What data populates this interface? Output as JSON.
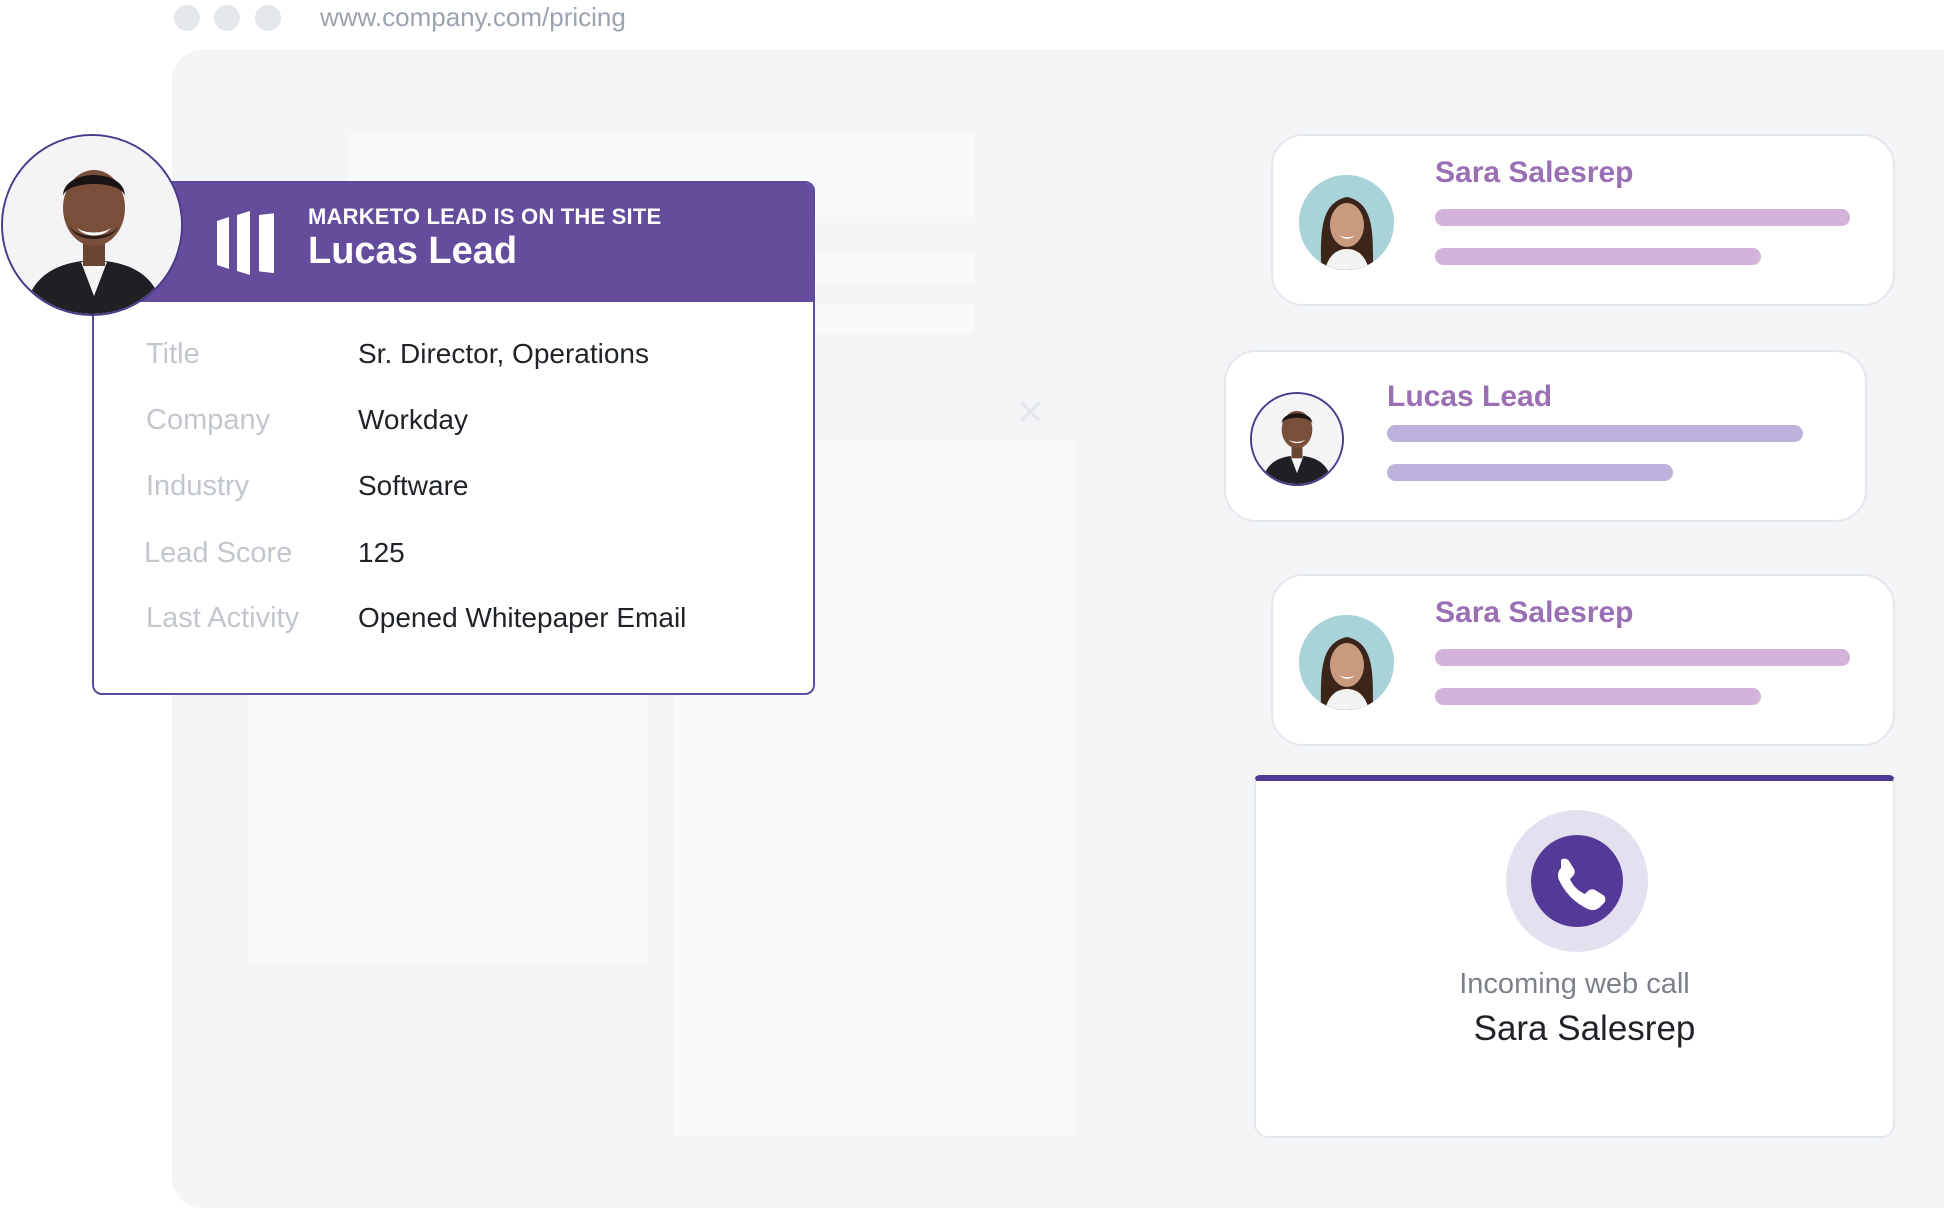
{
  "browser": {
    "url": "www.company.com/pricing"
  },
  "lead_card": {
    "kicker": "MARKETO LEAD IS ON THE SITE",
    "name": "Lucas Lead",
    "fields": [
      {
        "label": "Title",
        "value": "Sr. Director, Operations"
      },
      {
        "label": "Company",
        "value": "Workday"
      },
      {
        "label": "Industry",
        "value": "Software"
      },
      {
        "label": "Lead Score",
        "value": "125"
      },
      {
        "label": "Last Activity",
        "value": "Opened Whitepaper Email"
      }
    ]
  },
  "chats": [
    {
      "name": "Sara Salesrep"
    },
    {
      "name": "Lucas Lead"
    },
    {
      "name": "Sara Salesrep"
    }
  ],
  "call": {
    "label": "Incoming web call",
    "caller": "Sara Salesrep"
  },
  "colors": {
    "brand_purple": "#634d9c",
    "chat_name": "#9a6fb4",
    "bar_pink": "#d4b3da",
    "bar_lavender": "#bdb2db",
    "call_button": "#533a96"
  }
}
